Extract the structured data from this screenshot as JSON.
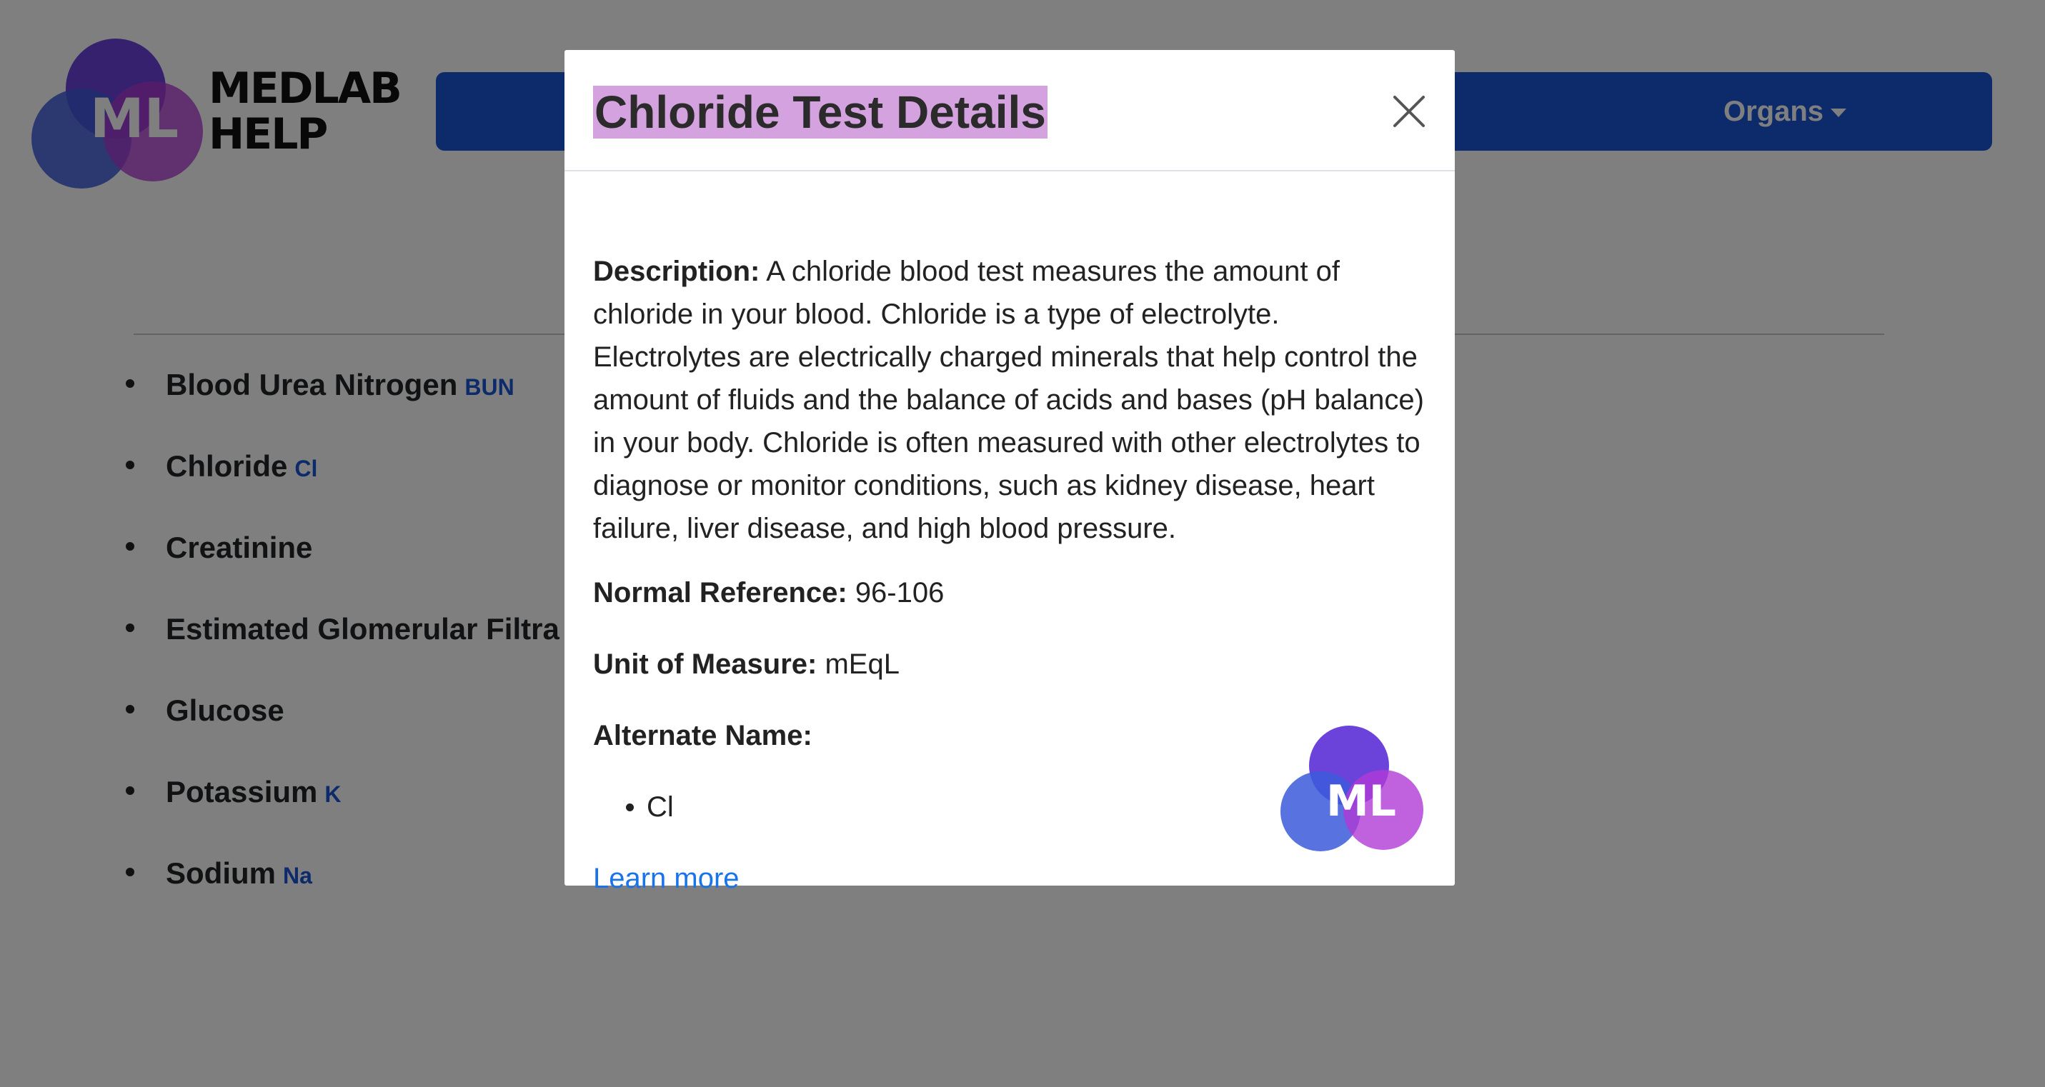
{
  "brand": {
    "logo_letters": "ML",
    "line1": "MEDLAB",
    "line2": "HELP"
  },
  "navbar": {
    "organs_label": "Organs"
  },
  "tests": [
    {
      "name": "Blood Urea Nitrogen",
      "abbr": "BUN"
    },
    {
      "name": "Chloride",
      "abbr": "Cl"
    },
    {
      "name": "Creatinine",
      "abbr": ""
    },
    {
      "name": "Estimated Glomerular Filtra",
      "abbr": ""
    },
    {
      "name": "Glucose",
      "abbr": ""
    },
    {
      "name": "Potassium",
      "abbr": "K"
    },
    {
      "name": "Sodium",
      "abbr": "Na"
    }
  ],
  "modal": {
    "title": "Chloride Test Details",
    "description_label": "Description:",
    "description": "A chloride blood test measures the amount of chloride in your blood. Chloride is a type of electrolyte. Electrolytes are electrically charged minerals that help control the amount of fluids and the balance of acids and bases (pH balance) in your body. Chloride is often measured with other electrolytes to diagnose or monitor conditions, such as kidney disease, heart failure, liver disease, and high blood pressure.",
    "normal_reference_label": "Normal Reference:",
    "normal_reference": "96-106",
    "unit_label": "Unit of Measure:",
    "unit": "mEqL",
    "alternate_name_label": "Alternate Name:",
    "alternate_names": [
      "Cl"
    ],
    "learn_more": "Learn more"
  },
  "colors": {
    "navbar": "#1a56d6",
    "abbr": "#1a56d6",
    "title_highlight": "#d5a2e0",
    "link": "#1a73e8",
    "logo_blue": "#3b5bdb",
    "logo_purple": "#5b2fd6",
    "logo_magenta": "#b03ad6"
  },
  "icons": {
    "close": "close-icon",
    "dropdown": "caret-down-icon"
  }
}
